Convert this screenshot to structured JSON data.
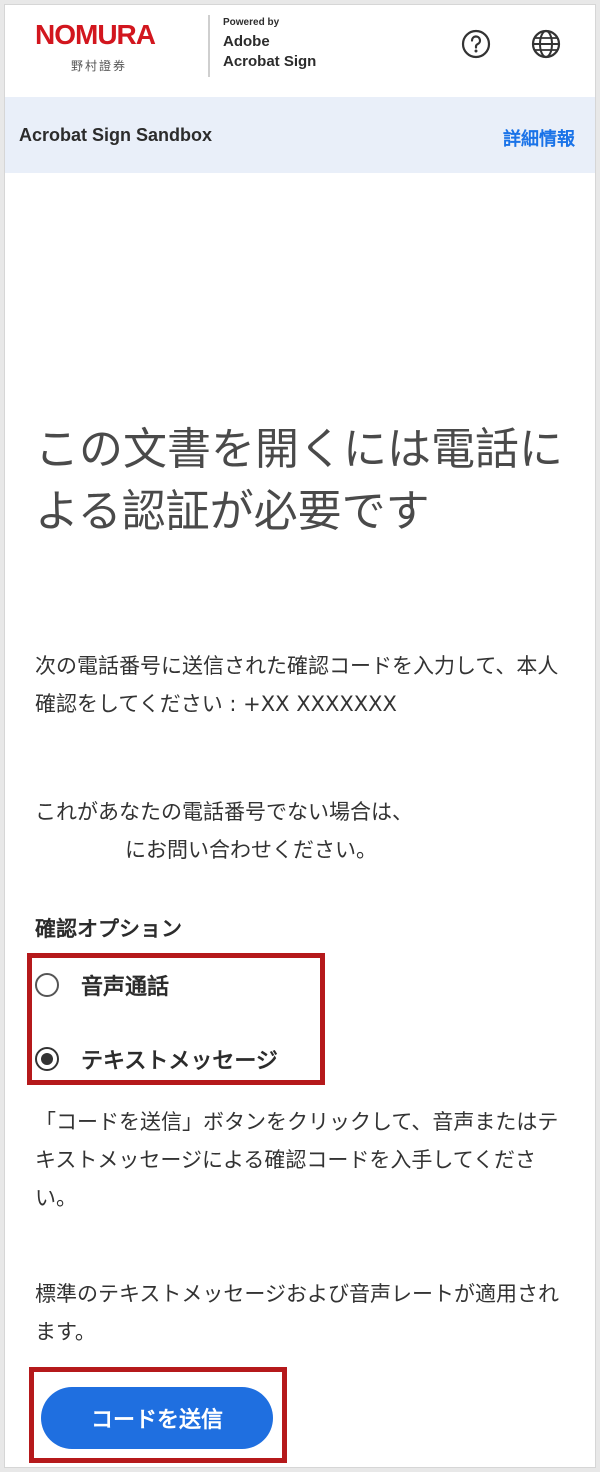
{
  "header": {
    "brand_name": "NOMURA",
    "brand_sub": "野村證券",
    "powered_by": "Powered by",
    "powered_line1": "Adobe",
    "powered_line2": "Acrobat Sign",
    "help_icon": "help-circle-icon",
    "globe_icon": "globe-icon"
  },
  "sandbox": {
    "title": "Acrobat Sign Sandbox",
    "details_link": "詳細情報"
  },
  "main": {
    "heading": "この文書を開くには電話による認証が必要です",
    "instruction": "次の電話番号に送信された確認コードを入力して、本人確認をしてください : +XX XXXXXXX",
    "not_your_number_line1": "これがあなたの電話番号でない場合は、",
    "not_your_number_line2": "にお問い合わせください。",
    "options_label": "確認オプション",
    "options": [
      {
        "label": "音声通話",
        "selected": false
      },
      {
        "label": "テキストメッセージ",
        "selected": true
      }
    ],
    "send_instruction": "「コードを送信」ボタンをクリックして、音声またはテキストメッセージによる確認コードを入手してください。",
    "rates_notice": "標準のテキストメッセージおよび音声レートが適用されます。",
    "submit_label": "コードを送信"
  },
  "colors": {
    "brand_red": "#d2161e",
    "link_blue": "#1a73e8",
    "button_blue": "#1f6fe0",
    "highlight_red": "#b5191b",
    "sandbox_bg": "#e9eff9"
  }
}
